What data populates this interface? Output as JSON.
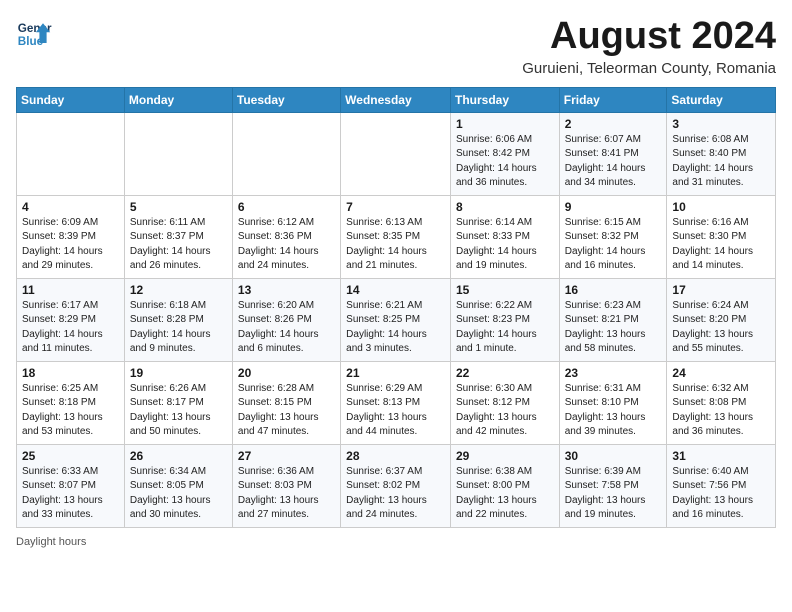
{
  "header": {
    "logo_line1": "General",
    "logo_line2": "Blue",
    "title": "August 2024",
    "subtitle": "Guruieni, Teleorman County, Romania"
  },
  "calendar": {
    "days_of_week": [
      "Sunday",
      "Monday",
      "Tuesday",
      "Wednesday",
      "Thursday",
      "Friday",
      "Saturday"
    ],
    "weeks": [
      [
        {
          "day": "",
          "info": ""
        },
        {
          "day": "",
          "info": ""
        },
        {
          "day": "",
          "info": ""
        },
        {
          "day": "",
          "info": ""
        },
        {
          "day": "1",
          "info": "Sunrise: 6:06 AM\nSunset: 8:42 PM\nDaylight: 14 hours and 36 minutes."
        },
        {
          "day": "2",
          "info": "Sunrise: 6:07 AM\nSunset: 8:41 PM\nDaylight: 14 hours and 34 minutes."
        },
        {
          "day": "3",
          "info": "Sunrise: 6:08 AM\nSunset: 8:40 PM\nDaylight: 14 hours and 31 minutes."
        }
      ],
      [
        {
          "day": "4",
          "info": "Sunrise: 6:09 AM\nSunset: 8:39 PM\nDaylight: 14 hours and 29 minutes."
        },
        {
          "day": "5",
          "info": "Sunrise: 6:11 AM\nSunset: 8:37 PM\nDaylight: 14 hours and 26 minutes."
        },
        {
          "day": "6",
          "info": "Sunrise: 6:12 AM\nSunset: 8:36 PM\nDaylight: 14 hours and 24 minutes."
        },
        {
          "day": "7",
          "info": "Sunrise: 6:13 AM\nSunset: 8:35 PM\nDaylight: 14 hours and 21 minutes."
        },
        {
          "day": "8",
          "info": "Sunrise: 6:14 AM\nSunset: 8:33 PM\nDaylight: 14 hours and 19 minutes."
        },
        {
          "day": "9",
          "info": "Sunrise: 6:15 AM\nSunset: 8:32 PM\nDaylight: 14 hours and 16 minutes."
        },
        {
          "day": "10",
          "info": "Sunrise: 6:16 AM\nSunset: 8:30 PM\nDaylight: 14 hours and 14 minutes."
        }
      ],
      [
        {
          "day": "11",
          "info": "Sunrise: 6:17 AM\nSunset: 8:29 PM\nDaylight: 14 hours and 11 minutes."
        },
        {
          "day": "12",
          "info": "Sunrise: 6:18 AM\nSunset: 8:28 PM\nDaylight: 14 hours and 9 minutes."
        },
        {
          "day": "13",
          "info": "Sunrise: 6:20 AM\nSunset: 8:26 PM\nDaylight: 14 hours and 6 minutes."
        },
        {
          "day": "14",
          "info": "Sunrise: 6:21 AM\nSunset: 8:25 PM\nDaylight: 14 hours and 3 minutes."
        },
        {
          "day": "15",
          "info": "Sunrise: 6:22 AM\nSunset: 8:23 PM\nDaylight: 14 hours and 1 minute."
        },
        {
          "day": "16",
          "info": "Sunrise: 6:23 AM\nSunset: 8:21 PM\nDaylight: 13 hours and 58 minutes."
        },
        {
          "day": "17",
          "info": "Sunrise: 6:24 AM\nSunset: 8:20 PM\nDaylight: 13 hours and 55 minutes."
        }
      ],
      [
        {
          "day": "18",
          "info": "Sunrise: 6:25 AM\nSunset: 8:18 PM\nDaylight: 13 hours and 53 minutes."
        },
        {
          "day": "19",
          "info": "Sunrise: 6:26 AM\nSunset: 8:17 PM\nDaylight: 13 hours and 50 minutes."
        },
        {
          "day": "20",
          "info": "Sunrise: 6:28 AM\nSunset: 8:15 PM\nDaylight: 13 hours and 47 minutes."
        },
        {
          "day": "21",
          "info": "Sunrise: 6:29 AM\nSunset: 8:13 PM\nDaylight: 13 hours and 44 minutes."
        },
        {
          "day": "22",
          "info": "Sunrise: 6:30 AM\nSunset: 8:12 PM\nDaylight: 13 hours and 42 minutes."
        },
        {
          "day": "23",
          "info": "Sunrise: 6:31 AM\nSunset: 8:10 PM\nDaylight: 13 hours and 39 minutes."
        },
        {
          "day": "24",
          "info": "Sunrise: 6:32 AM\nSunset: 8:08 PM\nDaylight: 13 hours and 36 minutes."
        }
      ],
      [
        {
          "day": "25",
          "info": "Sunrise: 6:33 AM\nSunset: 8:07 PM\nDaylight: 13 hours and 33 minutes."
        },
        {
          "day": "26",
          "info": "Sunrise: 6:34 AM\nSunset: 8:05 PM\nDaylight: 13 hours and 30 minutes."
        },
        {
          "day": "27",
          "info": "Sunrise: 6:36 AM\nSunset: 8:03 PM\nDaylight: 13 hours and 27 minutes."
        },
        {
          "day": "28",
          "info": "Sunrise: 6:37 AM\nSunset: 8:02 PM\nDaylight: 13 hours and 24 minutes."
        },
        {
          "day": "29",
          "info": "Sunrise: 6:38 AM\nSunset: 8:00 PM\nDaylight: 13 hours and 22 minutes."
        },
        {
          "day": "30",
          "info": "Sunrise: 6:39 AM\nSunset: 7:58 PM\nDaylight: 13 hours and 19 minutes."
        },
        {
          "day": "31",
          "info": "Sunrise: 6:40 AM\nSunset: 7:56 PM\nDaylight: 13 hours and 16 minutes."
        }
      ]
    ]
  },
  "footer": {
    "label": "Daylight hours"
  }
}
